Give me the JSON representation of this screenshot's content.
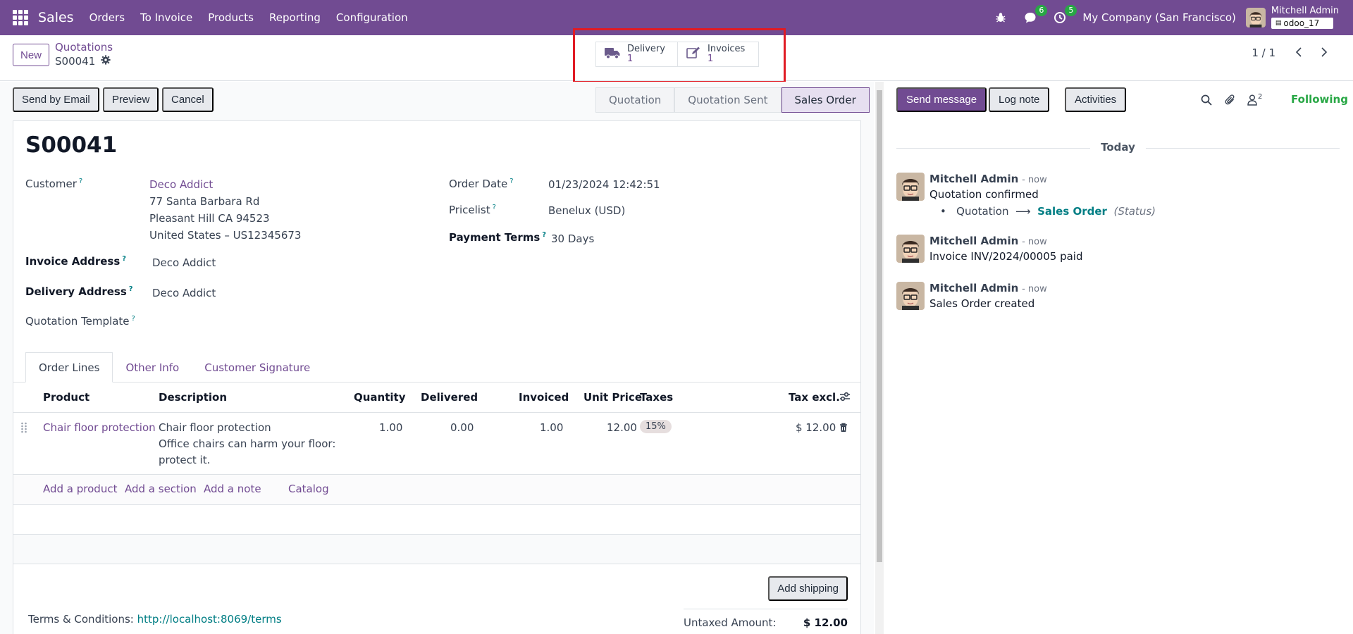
{
  "navbar": {
    "app_name": "Sales",
    "menu": [
      "Orders",
      "To Invoice",
      "Products",
      "Reporting",
      "Configuration"
    ],
    "messages_count": "6",
    "activities_count": "5",
    "company": "My Company (San Francisco)",
    "user_name": "Mitchell Admin",
    "db_name": "odoo_17",
    "colors": {
      "brand": "#714b92",
      "badge": "#28a745"
    }
  },
  "control_panel": {
    "new_label": "New",
    "breadcrumb": "Quotations",
    "record_name": "S00041",
    "smart_buttons": [
      {
        "label": "Delivery",
        "value": "1",
        "icon": "truck-icon"
      },
      {
        "label": "Invoices",
        "value": "1",
        "icon": "edit-icon"
      }
    ],
    "pager": "1 / 1"
  },
  "form": {
    "buttons": {
      "send_email": "Send by Email",
      "preview": "Preview",
      "cancel": "Cancel"
    },
    "status_steps": [
      "Quotation",
      "Quotation Sent",
      "Sales Order"
    ],
    "active_status": "Sales Order",
    "title": "S00041",
    "fields": {
      "customer_label": "Customer",
      "customer_name": "Deco Addict",
      "customer_address": [
        "77 Santa Barbara Rd",
        "Pleasant Hill CA 94523",
        "United States – US12345673"
      ],
      "invoice_address_label": "Invoice Address",
      "invoice_address": "Deco Addict",
      "delivery_address_label": "Delivery Address",
      "delivery_address": "Deco Addict",
      "quotation_template_label": "Quotation Template",
      "order_date_label": "Order Date",
      "order_date": "01/23/2024 12:42:51",
      "pricelist_label": "Pricelist",
      "pricelist": "Benelux (USD)",
      "payment_terms_label": "Payment Terms",
      "payment_terms": "30 Days"
    },
    "tabs": [
      "Order Lines",
      "Other Info",
      "Customer Signature"
    ],
    "columns": [
      "Product",
      "Description",
      "Quantity",
      "Delivered",
      "Invoiced",
      "Unit Price",
      "Taxes",
      "Tax excl."
    ],
    "lines": [
      {
        "product": "Chair floor protection",
        "description": [
          "Chair floor protection",
          "Office chairs can harm your floor:",
          "protect it."
        ],
        "quantity": "1.00",
        "delivered": "0.00",
        "invoiced": "1.00",
        "unit_price": "12.00",
        "taxes": "15%",
        "subtotal": "$ 12.00"
      }
    ],
    "add_links": [
      "Add a product",
      "Add a section",
      "Add a note",
      "Catalog"
    ],
    "add_shipping": "Add shipping",
    "terms_label": "Terms & Conditions:",
    "terms_link": "http://localhost:8069/terms",
    "untaxed_label": "Untaxed Amount:",
    "untaxed_value": "$ 12.00"
  },
  "chatter": {
    "send_message": "Send message",
    "log_note": "Log note",
    "activities": "Activities",
    "followers_count": "2",
    "following": "Following",
    "date_divider": "Today",
    "messages": [
      {
        "author": "Mitchell Admin",
        "date": "- now",
        "body": "Quotation confirmed",
        "track_old": "Quotation",
        "track_new": "Sales Order",
        "track_field": "(Status)"
      },
      {
        "author": "Mitchell Admin",
        "date": "- now",
        "body": "Invoice INV/2024/00005 paid"
      },
      {
        "author": "Mitchell Admin",
        "date": "- now",
        "body": "Sales Order created"
      }
    ]
  }
}
